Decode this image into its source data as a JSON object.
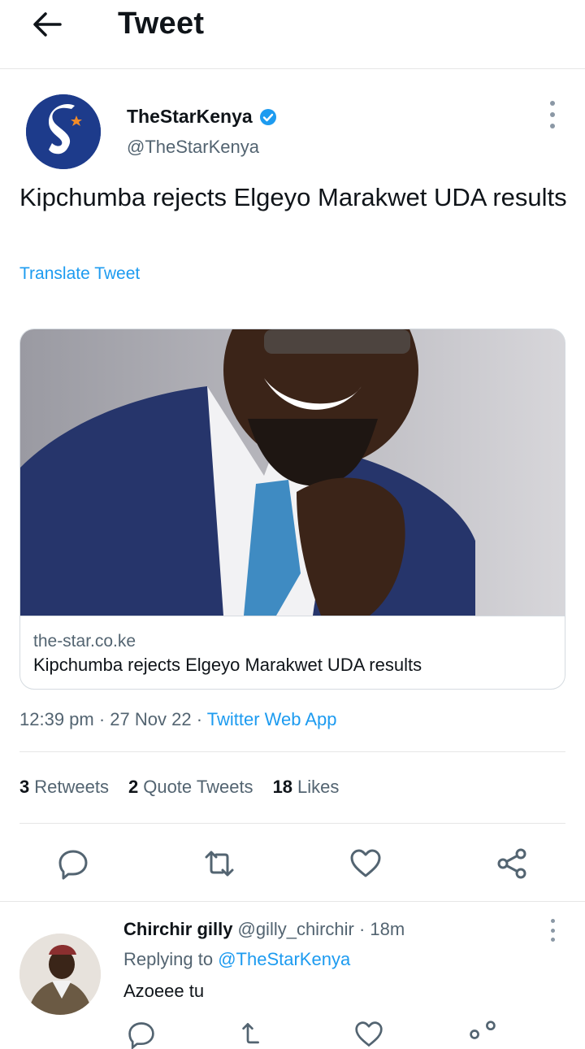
{
  "header": {
    "title": "Tweet",
    "back_icon": "arrow-left-icon"
  },
  "tweet": {
    "author_name": "TheStarKenya",
    "author_handle": "@TheStarKenya",
    "verified": true,
    "text": "Kipchumba rejects Elgeyo Marakwet UDA results",
    "translate_label": "Translate Tweet",
    "card": {
      "domain": "the-star.co.ke",
      "title": "Kipchumba rejects Elgeyo Marakwet UDA results"
    },
    "time": "12:39 pm",
    "date": "27 Nov 22",
    "source": "Twitter Web App",
    "stats": {
      "retweets_count": "3",
      "retweets_label": "Retweets",
      "quotes_count": "2",
      "quotes_label": "Quote Tweets",
      "likes_count": "18",
      "likes_label": "Likes"
    }
  },
  "reply": {
    "name": "Chirchir gilly",
    "handle": "@gilly_chirchir",
    "time": "18m",
    "replying_prefix": "Replying to",
    "replying_to": "@TheStarKenya",
    "text": "Azoeee tu"
  },
  "colors": {
    "accent": "#1d9bf0",
    "muted": "#536471",
    "text": "#0f1419"
  }
}
